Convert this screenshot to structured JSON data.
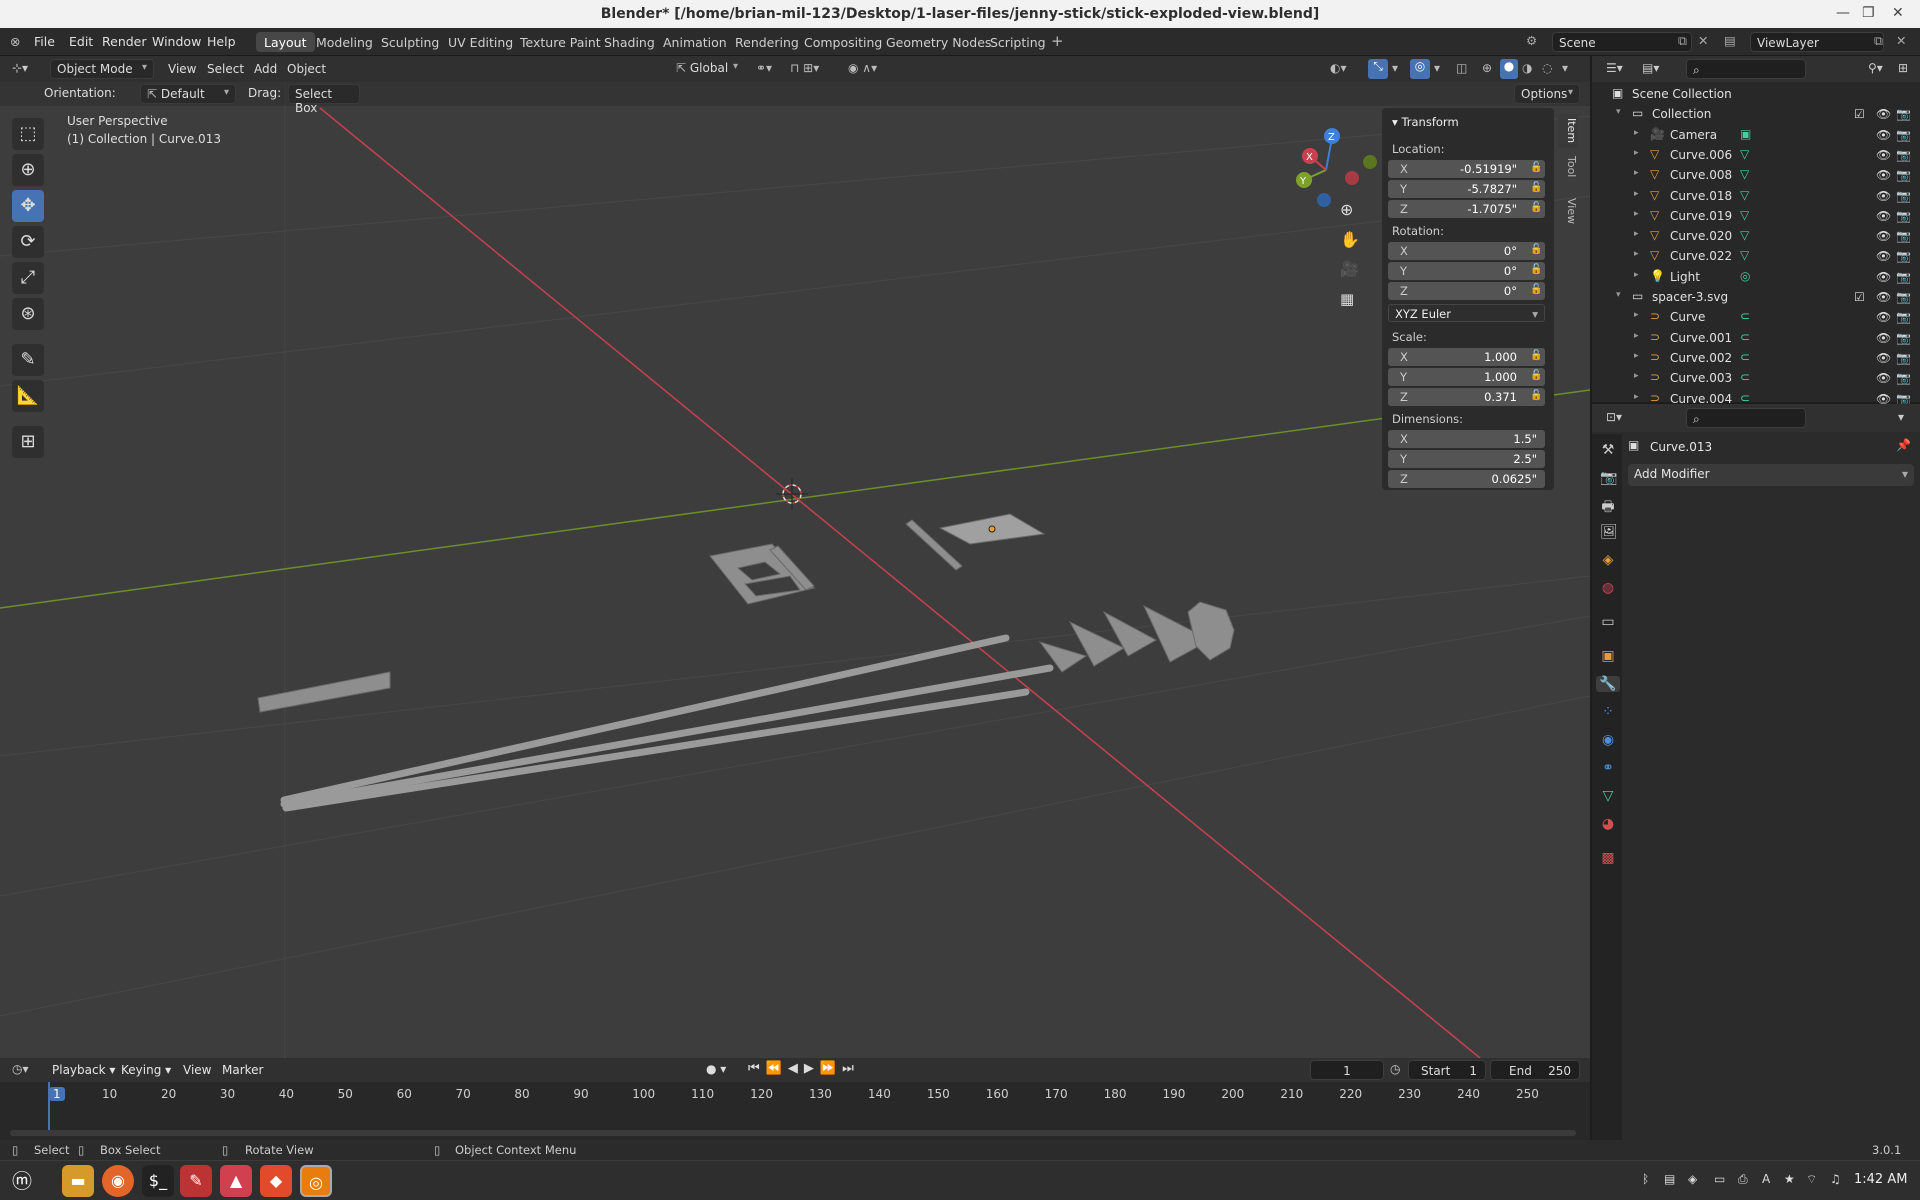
{
  "window": {
    "title": "Blender* [/home/brian-mil-123/Desktop/1-laser-files/jenny-stick/stick-exploded-view.blend]"
  },
  "menu": [
    "File",
    "Edit",
    "Render",
    "Window",
    "Help"
  ],
  "workspaces": [
    "Layout",
    "Modeling",
    "Sculpting",
    "UV Editing",
    "Texture Paint",
    "Shading",
    "Animation",
    "Rendering",
    "Compositing",
    "Geometry Nodes",
    "Scripting"
  ],
  "active_workspace": "Layout",
  "scene": {
    "label": "Scene",
    "view_layer": "ViewLayer"
  },
  "viewport": {
    "mode": "Object Mode",
    "menus": [
      "View",
      "Select",
      "Add",
      "Object"
    ],
    "transform_orientation": "Global",
    "orientation_label": "Orientation:",
    "orientation_value": "Default",
    "drag_label": "Drag:",
    "drag_value": "Select Box",
    "options": "Options",
    "perspective": "User Perspective",
    "collection_info": "(1) Collection | Curve.013",
    "gizmo": {
      "x": "X",
      "y": "Y",
      "z": "Z"
    }
  },
  "npanel": {
    "tabs": [
      "Item",
      "Tool",
      "View"
    ],
    "section": "Transform",
    "location_label": "Location:",
    "location": [
      {
        "axis": "X",
        "value": "-0.51919\""
      },
      {
        "axis": "Y",
        "value": "-5.7827\""
      },
      {
        "axis": "Z",
        "value": "-1.7075\""
      }
    ],
    "rotation_label": "Rotation:",
    "rotation": [
      {
        "axis": "X",
        "value": "0°"
      },
      {
        "axis": "Y",
        "value": "0°"
      },
      {
        "axis": "Z",
        "value": "0°"
      }
    ],
    "rotation_mode": "XYZ Euler",
    "scale_label": "Scale:",
    "scale": [
      {
        "axis": "X",
        "value": "1.000"
      },
      {
        "axis": "Y",
        "value": "1.000"
      },
      {
        "axis": "Z",
        "value": "0.371"
      }
    ],
    "dimensions_label": "Dimensions:",
    "dimensions": [
      {
        "axis": "X",
        "value": "1.5\""
      },
      {
        "axis": "Y",
        "value": "2.5\""
      },
      {
        "axis": "Z",
        "value": "0.0625\""
      }
    ]
  },
  "outliner": {
    "root": "Scene Collection",
    "rows": [
      {
        "name": "Collection",
        "kind": "collection",
        "level": 1
      },
      {
        "name": "Camera",
        "kind": "camera",
        "level": 2
      },
      {
        "name": "Curve.006",
        "kind": "mesh",
        "level": 2
      },
      {
        "name": "Curve.008",
        "kind": "mesh",
        "level": 2
      },
      {
        "name": "Curve.018",
        "kind": "mesh",
        "level": 2
      },
      {
        "name": "Curve.019",
        "kind": "mesh",
        "level": 2
      },
      {
        "name": "Curve.020",
        "kind": "mesh",
        "level": 2
      },
      {
        "name": "Curve.022",
        "kind": "mesh",
        "level": 2
      },
      {
        "name": "Light",
        "kind": "light",
        "level": 2
      },
      {
        "name": "spacer-3.svg",
        "kind": "collection",
        "level": 1
      },
      {
        "name": "Curve",
        "kind": "curve",
        "level": 2
      },
      {
        "name": "Curve.001",
        "kind": "curve",
        "level": 2
      },
      {
        "name": "Curve.002",
        "kind": "curve",
        "level": 2
      },
      {
        "name": "Curve.003",
        "kind": "curve",
        "level": 2
      },
      {
        "name": "Curve.004",
        "kind": "curve",
        "level": 2
      }
    ]
  },
  "properties": {
    "object_name": "Curve.013",
    "add_modifier": "Add Modifier"
  },
  "timeline": {
    "menus": [
      "Playback",
      "Keying",
      "View",
      "Marker"
    ],
    "current_frame": "1",
    "start_label": "Start",
    "start": "1",
    "end_label": "End",
    "end": "250",
    "ticks": [
      "1",
      "10",
      "20",
      "30",
      "40",
      "50",
      "60",
      "70",
      "80",
      "90",
      "100",
      "110",
      "120",
      "130",
      "140",
      "150",
      "160",
      "170",
      "180",
      "190",
      "200",
      "210",
      "220",
      "230",
      "240",
      "250"
    ]
  },
  "statusbar": {
    "select": "Select",
    "box_select": "Box Select",
    "rotate_view": "Rotate View",
    "context_menu": "Object Context Menu",
    "version": "3.0.1"
  },
  "taskbar": {
    "clock": "1:42 AM"
  },
  "colors": {
    "accent": "#4772b3",
    "x_axis": "#c9414f",
    "y_axis": "#7fa12a",
    "z_axis": "#3f7fd9",
    "mesh_icon": "#e59a3b",
    "data_icon": "#3fd0a0"
  }
}
